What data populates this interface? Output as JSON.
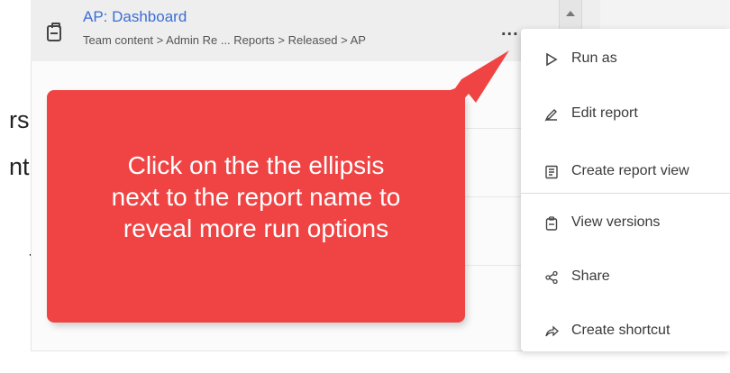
{
  "left_fragments": [
    "rs,",
    "nt,",
    "t"
  ],
  "header": {
    "title": "AP: Dashboard",
    "breadcrumb": "Team content > Admin Re ... Reports > Released > AP",
    "more_options": "...",
    "right_text": "..."
  },
  "callout": {
    "lines": [
      "Click on the the ellipsis",
      "next to the report name to",
      "reveal more run options"
    ],
    "color": "#f04444"
  },
  "menu": {
    "items": [
      {
        "label": "Run as",
        "icon": "play-outline-icon"
      },
      {
        "label": "Edit report",
        "icon": "pencil-icon"
      },
      {
        "label": "Create report view",
        "icon": "report-view-icon"
      },
      {
        "label": "View versions",
        "icon": "clipboard-icon"
      },
      {
        "label": "Share",
        "icon": "share-icon"
      },
      {
        "label": "Create shortcut",
        "icon": "shortcut-arrow-icon"
      }
    ]
  },
  "colors": {
    "link_blue": "#3b6ed6",
    "header_gray": "#eeeeee"
  }
}
